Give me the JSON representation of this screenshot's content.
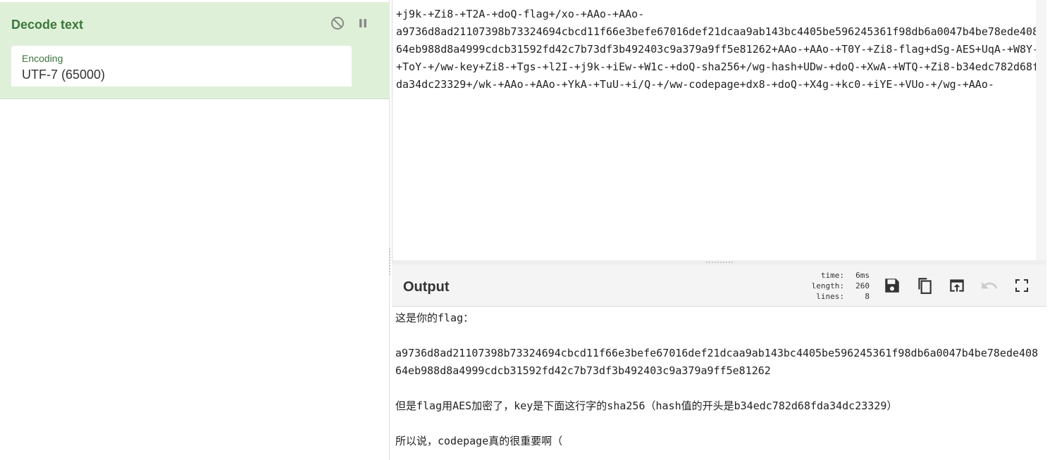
{
  "recipe": {
    "operation_title": "Decode text",
    "encoding_label": "Encoding",
    "encoding_value": "UTF-7 (65000)",
    "icons": {
      "disable": "disable-icon",
      "pause": "pause-icon"
    }
  },
  "input": {
    "text": "+j9k-+Zi8-+T2A-+doQ-flag+/xo-+AAo-+AAo-\na9736d8ad21107398b73324694cbcd11f66e3befe67016def21dcaa9ab143bc4405be596245361f98db6a0047b4be78ede40864eb988d8a4999cdcb31592fd42c7b73df3b492403c9a379a9ff5e81262+AAo-+AAo-+T0Y-+Zi8-flag+dSg-AES+UqA-+W8Y-+ToY-+/ww-key+Zi8-+Tgs-+l2I-+j9k-+iEw-+W1c-+doQ-sha256+/wg-hash+UDw-+doQ-+XwA-+WTQ-+Zi8-b34edc782d68fda34dc23329+/wk-+AAo-+AAo-+YkA-+TuU-+i/Q-+/ww-codepage+dx8-+doQ-+X4g-+kc0-+iYE-+VUo-+/wg-+AAo-"
  },
  "output": {
    "title": "Output",
    "stats": {
      "time_label": "time:",
      "time_value": "6ms",
      "length_label": "length:",
      "length_value": "260",
      "lines_label": "lines:",
      "lines_value": "8"
    },
    "text": "这是你的flag：\n\na9736d8ad21107398b73324694cbcd11f66e3befe67016def21dcaa9ab143bc4405be596245361f98db6a0047b4be78ede40864eb988d8a4999cdcb31592fd42c7b73df3b492403c9a379a9ff5e81262\n\n但是flag用AES加密了，key是下面这行字的sha256（hash值的开头是b34edc782d68fda34dc23329）\n\n所以说，codepage真的很重要啊（",
    "buttons": {
      "save": "save-icon",
      "copy": "copy-icon",
      "replace_input": "replace-input-icon",
      "undo": "undo-icon",
      "maximise": "maximise-icon"
    }
  },
  "colors": {
    "operation_bg": "#dff0d8",
    "operation_title": "#3c763d",
    "panel_header_bg": "#f4f4f4",
    "disabled_icon": "#cccccc"
  }
}
